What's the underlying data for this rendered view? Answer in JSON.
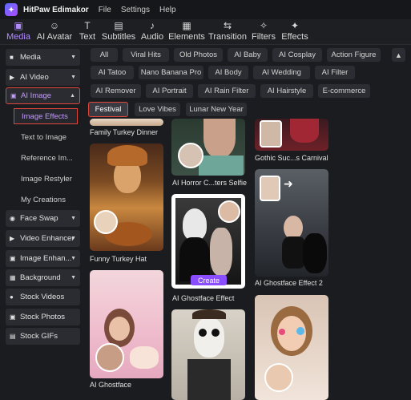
{
  "titlebar": {
    "app_name": "HitPaw Edimakor",
    "menus": [
      "File",
      "Settings",
      "Help"
    ]
  },
  "toolbar": {
    "items": [
      {
        "label": "Media",
        "icon": "media-icon",
        "active": true
      },
      {
        "label": "AI Avatar",
        "icon": "avatar-icon"
      },
      {
        "label": "Text",
        "icon": "text-icon"
      },
      {
        "label": "Subtitles",
        "icon": "subtitles-icon"
      },
      {
        "label": "Audio",
        "icon": "audio-icon"
      },
      {
        "label": "Elements",
        "icon": "elements-icon"
      },
      {
        "label": "Transition",
        "icon": "transition-icon"
      },
      {
        "label": "Filters",
        "icon": "filters-icon"
      },
      {
        "label": "Effects",
        "icon": "effects-icon"
      }
    ]
  },
  "sidebar": {
    "items": [
      {
        "label": "Media"
      },
      {
        "label": "AI Video"
      },
      {
        "label": "AI Image"
      },
      {
        "label": "Face Swap"
      },
      {
        "label": "Video Enhancer"
      },
      {
        "label": "Image Enhan..."
      },
      {
        "label": "Background"
      },
      {
        "label": "Stock Videos"
      },
      {
        "label": "Stock Photos"
      },
      {
        "label": "Stock GIFs"
      }
    ],
    "sub_items": [
      {
        "label": "Image Effects"
      },
      {
        "label": "Text to Image"
      },
      {
        "label": "Reference Im..."
      },
      {
        "label": "Image Restyler"
      },
      {
        "label": "My Creations"
      }
    ]
  },
  "chips": {
    "row1": [
      "All",
      "Viral Hits",
      "Old Photos",
      "AI Baby",
      "AI Cosplay",
      "Action Figure"
    ],
    "row2": [
      "AI Tatoo",
      "Nano Banana Pro",
      "AI Body",
      "AI Wedding",
      "AI Filter"
    ],
    "row3": [
      "AI Remover",
      "AI Portrait",
      "AI Rain Filter",
      "AI Hairstyle",
      "E-commerce"
    ],
    "row4": [
      "Festival",
      "Love Vibes",
      "Lunar New Year"
    ]
  },
  "grid": {
    "captions": {
      "family_turkey": "Family Turkey Dinner",
      "gothic_carnival": "Gothic Suc...s Carnival",
      "horror_selfie": "AI Horror C...ters Selfie",
      "funny_turkey": "Funny Turkey Hat",
      "ghostface_effect": "AI Ghostface Effect",
      "ghostface_effect_2": "AI Ghostface Effect 2",
      "ghostface": "AI Ghostface"
    },
    "create_label": "Create"
  },
  "colors": {
    "accent": "#b28cff",
    "highlight_box": "#e0463a",
    "create_button": "#8a4dff"
  }
}
